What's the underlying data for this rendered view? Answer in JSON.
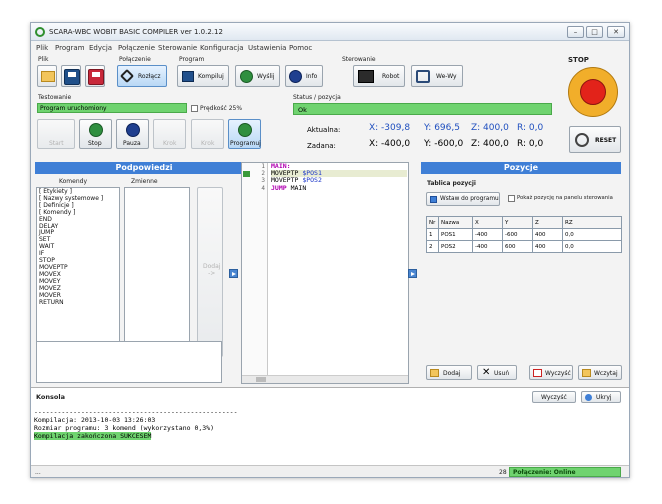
{
  "window": {
    "title": "SCARA-WBC WOBIT BASIC COMPILER ver 1.0.2.12",
    "controls": [
      "–",
      "□",
      "✕"
    ]
  },
  "menu": [
    "Plik",
    "Program",
    "Edycja",
    "Połączenie",
    "Sterowanie",
    "Konfiguracja",
    "Ustawienia",
    "Pomoc"
  ],
  "toolbar": {
    "group_plik": "Plik",
    "group_polaczenie": "Połączenie",
    "group_program": "Program",
    "group_sterowanie": "Sterowanie",
    "group_stop": "STOP",
    "rozlacz": "Rozłącz",
    "kompiluj": "Kompiluj",
    "wyslij": "Wyślij",
    "info": "Info",
    "robot": "Robot",
    "wewy": "We-Wy",
    "reset": "RESET"
  },
  "testing": {
    "label": "Testowanie",
    "status": "Program uruchomiony",
    "speed_label": "Prędkość 25%",
    "buttons": {
      "start": "Start",
      "stop": "Stop",
      "pause": "Pauza",
      "step1": "Krok",
      "step2": "Krok",
      "program": "Programuj"
    }
  },
  "status": {
    "label": "Status / pozycja",
    "value": "Ok",
    "actual_label": "Aktualna:",
    "set_label": "Zadana:",
    "actual": {
      "x": "X: -309,8",
      "y": "Y: 696,5",
      "z": "Z: 400,0",
      "r": "R:  0,0"
    },
    "set": {
      "x": "X: -400,0",
      "y": "Y: -600,0",
      "z": "Z: 400,0",
      "r": "R:  0,0"
    }
  },
  "hints": {
    "title": "Podpowiedzi",
    "col_commands": "Komendy",
    "col_variables": "Zmienne",
    "commands": [
      "[ Etykiety ]",
      "[ Nazwy systemowe ]",
      "[ Definicje ]",
      "[ Komendy ]",
      "END",
      "DELAY",
      "JUMP",
      "SET",
      "WAIT",
      "IF",
      "STOP",
      "MOVEPTP",
      "MOVEX",
      "MOVEY",
      "MOVEZ",
      "MOVER",
      "RETURN"
    ],
    "add_button": "Dodaj\n->"
  },
  "editor": {
    "lines": [
      {
        "num": "1",
        "parts": [
          {
            "t": "MAIN:",
            "c": "kw"
          }
        ]
      },
      {
        "num": "2",
        "parts": [
          {
            "t": "MOVEPTP ",
            "c": ""
          },
          {
            "t": "$POS1",
            "c": "var"
          }
        ]
      },
      {
        "num": "3",
        "parts": [
          {
            "t": "MOVEPTP ",
            "c": ""
          },
          {
            "t": "$POS2",
            "c": "var"
          }
        ]
      },
      {
        "num": "4",
        "parts": [
          {
            "t": "JUMP ",
            "c": "kw"
          },
          {
            "t": "MAIN",
            "c": ""
          }
        ]
      }
    ]
  },
  "positions": {
    "title": "Pozycje",
    "table_label": "Tablica pozycji",
    "insert_button": "Wstaw do programu",
    "show_on_panel": "Pokaż pozycję na panelu sterowania",
    "headers": [
      "Nr",
      "Nazwa",
      "X",
      "Y",
      "Z",
      "RZ"
    ],
    "rows": [
      [
        "1",
        "POS1",
        "-400",
        "-600",
        "400",
        "0,0"
      ],
      [
        "2",
        "POS2",
        "-400",
        "600",
        "400",
        "0,0"
      ]
    ],
    "add": "Dodaj",
    "remove": "Usuń",
    "clear": "Wyczyść",
    "load": "Wczytaj"
  },
  "console": {
    "title": "Konsola",
    "clear": "Wyczyść",
    "hide": "Ukryj",
    "lines": [
      "----------------------------------------------------",
      "Kompilacja: 2013-10-03 13:26:03",
      "Rozmiar programu: 3 komend (wykorzystano 0,3%)",
      "Kompilacja zakończona SUKCESEM"
    ]
  },
  "statusbar": {
    "left": "...",
    "number": "28",
    "connection": "Połączenie: Online"
  },
  "colors": {
    "accent_blue": "#3f7fd6",
    "status_green": "#6fd36f",
    "stop_red": "#e2231a"
  }
}
